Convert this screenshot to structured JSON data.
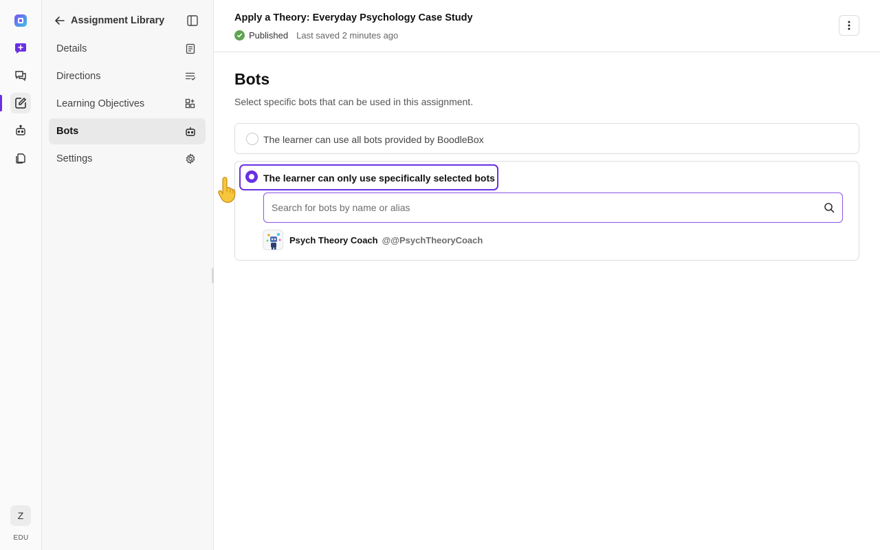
{
  "rail": {
    "items": [
      {
        "name": "logo",
        "icon": "boodlebox-logo-icon"
      },
      {
        "name": "new-chat",
        "icon": "chat-plus-icon"
      },
      {
        "name": "chats",
        "icon": "chats-icon"
      },
      {
        "name": "assignments",
        "icon": "edit-document-icon",
        "active": true
      },
      {
        "name": "bots",
        "icon": "bot-icon"
      },
      {
        "name": "files",
        "icon": "files-icon"
      }
    ],
    "avatar_initial": "Z",
    "plan_label": "EDU"
  },
  "sidebar": {
    "back_label": "Assignment Library",
    "items": [
      {
        "label": "Details",
        "icon": "document-list-icon"
      },
      {
        "label": "Directions",
        "icon": "checklist-icon"
      },
      {
        "label": "Learning Objectives",
        "icon": "grid-plus-icon"
      },
      {
        "label": "Bots",
        "icon": "bot-icon",
        "active": true
      },
      {
        "label": "Settings",
        "icon": "gear-icon"
      }
    ]
  },
  "header": {
    "title": "Apply a Theory: Everyday Psychology Case Study",
    "status": "Published",
    "saved": "Last saved 2 minutes ago"
  },
  "bots_section": {
    "title": "Bots",
    "description": "Select specific bots that can be used in this assignment.",
    "option_all_label": "The learner can use all bots provided by BoodleBox",
    "option_selected_label": "The learner can only use specifically selected bots",
    "selected_option": "specific",
    "search": {
      "placeholder": "Search for bots by name or alias",
      "value": ""
    },
    "bots": [
      {
        "name": "Psych Theory Coach",
        "alias": "@@PsychTheoryCoach"
      }
    ]
  },
  "colors": {
    "accent": "#6a2fe3",
    "published": "#5ea44f"
  }
}
